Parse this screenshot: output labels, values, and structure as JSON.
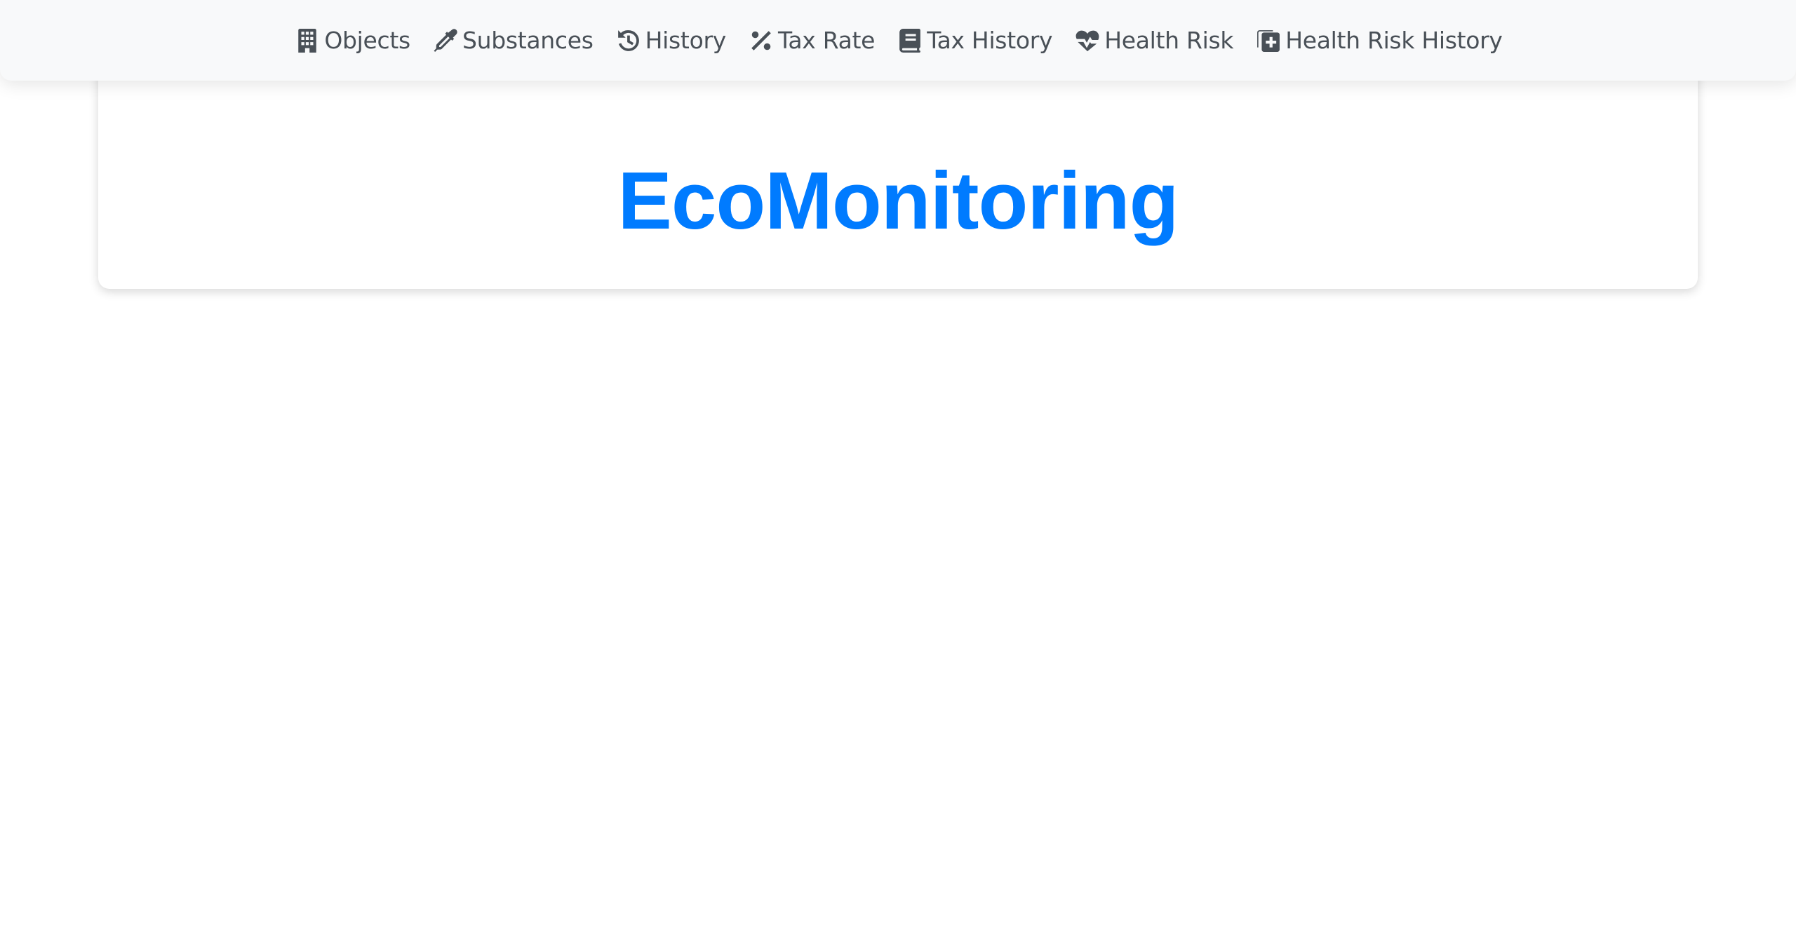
{
  "nav": {
    "items": [
      {
        "label": "Objects",
        "icon": "building-icon"
      },
      {
        "label": "Substances",
        "icon": "eyedropper-icon"
      },
      {
        "label": "History",
        "icon": "history-icon"
      },
      {
        "label": "Tax Rate",
        "icon": "percent-icon"
      },
      {
        "label": "Tax History",
        "icon": "book-icon"
      },
      {
        "label": "Health Risk",
        "icon": "heart-pulse-icon"
      },
      {
        "label": "Health Risk History",
        "icon": "file-medical-icon"
      }
    ]
  },
  "hero": {
    "title": "EcoMonitoring",
    "title_color": "#007bff"
  },
  "colors": {
    "nav_background": "#f8f9fa",
    "nav_text": "#495057",
    "accent": "#007bff"
  }
}
